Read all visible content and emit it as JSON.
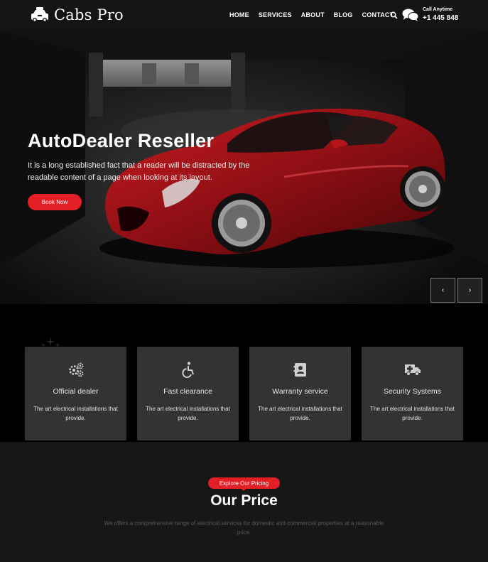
{
  "header": {
    "logo_text": "Cabs Pro",
    "logo_icon": "taxi-icon",
    "nav": [
      "HOME",
      "SERVICES",
      "ABOUT",
      "BLOG",
      "CONTACT"
    ],
    "search_icon": "search-icon",
    "call_label": "Call Anytime",
    "call_number": "+1 445 848",
    "call_icon": "chat-bubbles-icon"
  },
  "hero": {
    "title": "AutoDealer Reseller",
    "text": "It is a long established fact that a reader will be distracted by the readable content of a page when looking at its layout.",
    "button": "Book Now",
    "prev_label": "‹",
    "next_label": "›"
  },
  "features": [
    {
      "icon": "gears-icon",
      "title": "Official dealer",
      "desc": "The art electrical installations that provide."
    },
    {
      "icon": "accessible-icon",
      "title": "Fast clearance",
      "desc": "The art electrical installations that provide."
    },
    {
      "icon": "id-card-icon",
      "title": "Warranty service",
      "desc": "The art electrical installations that provide."
    },
    {
      "icon": "ambulance-icon",
      "title": "Security Systems",
      "desc": "The art electrical installations that provide."
    }
  ],
  "pricing": {
    "badge": "Explore Our Pricing",
    "title": "Our Price",
    "desc": "We offers a comprehensive range of electrical services for domestic and commercial properties at a reasonable price."
  },
  "colors": {
    "accent": "#e31e24",
    "header_bg": "#141414",
    "card_bg": "#333333",
    "pricing_bg": "#171717"
  }
}
